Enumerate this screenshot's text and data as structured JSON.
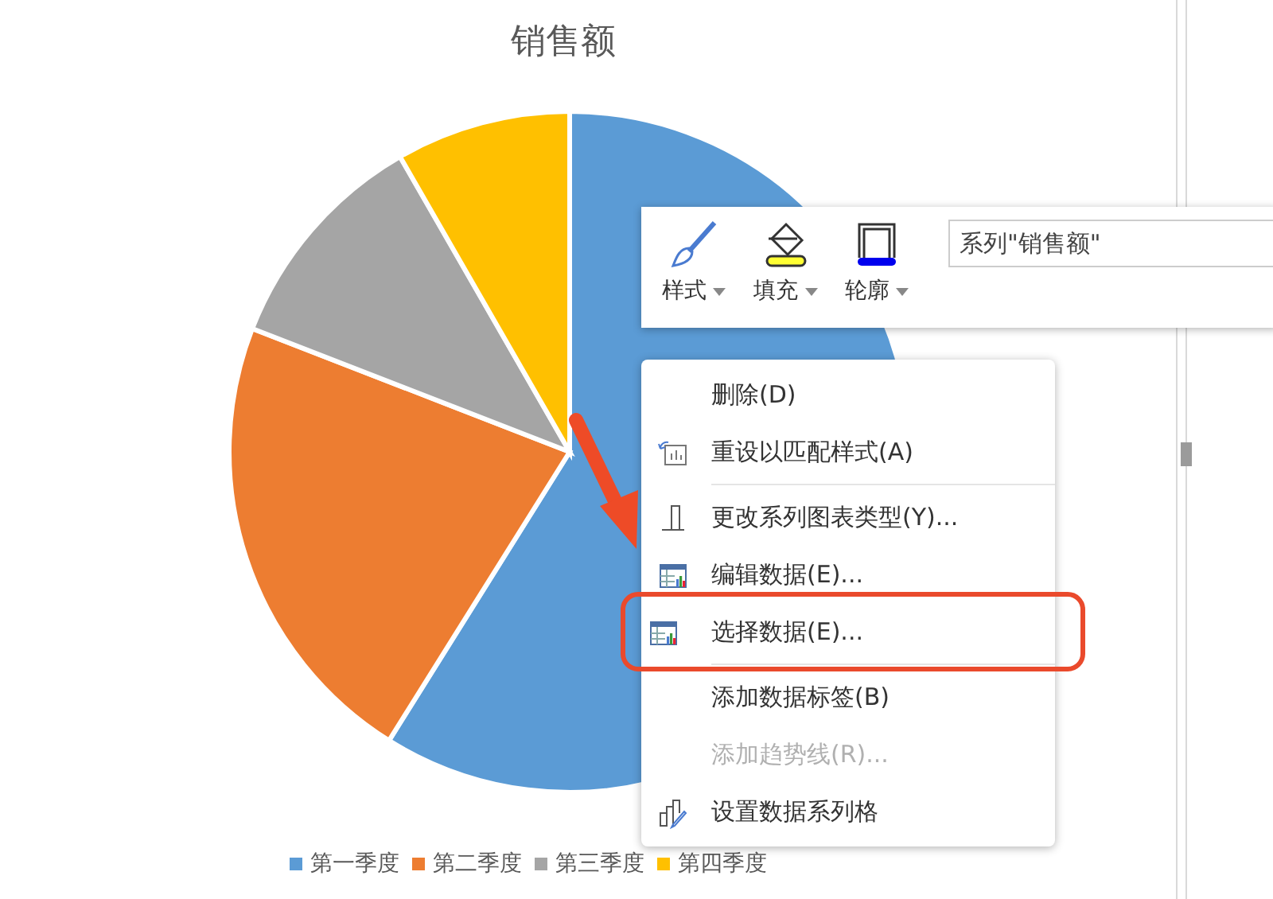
{
  "chart": {
    "title": "销售额",
    "legend": [
      {
        "label": "第一季度",
        "color": "#5b9bd5"
      },
      {
        "label": "第二季度",
        "color": "#ed7d31"
      },
      {
        "label": "第三季度",
        "color": "#a5a5a5"
      },
      {
        "label": "第四季度",
        "color": "#ffc000"
      }
    ]
  },
  "format_toolbar": {
    "buttons": [
      {
        "kind": "style",
        "label": "样式"
      },
      {
        "kind": "fill",
        "label": "填充"
      },
      {
        "kind": "outline",
        "label": "轮廓"
      }
    ],
    "series_field": {
      "value": "系列\"销售额\""
    }
  },
  "context_menu": {
    "items": [
      {
        "kind": "plain",
        "label": "删除(D)",
        "disabled": false,
        "highlighted": false
      },
      {
        "kind": "reset",
        "label": "重设以匹配样式(A)",
        "disabled": false,
        "highlighted": false
      },
      {
        "kind": "separator"
      },
      {
        "kind": "chart-type",
        "label": "更改系列图表类型(Y)...",
        "disabled": false,
        "highlighted": false
      },
      {
        "kind": "data",
        "label": "编辑数据(E)...",
        "disabled": false,
        "highlighted": false
      },
      {
        "kind": "data",
        "label": "选择数据(E)...",
        "disabled": false,
        "highlighted": true
      },
      {
        "kind": "separator"
      },
      {
        "kind": "plain",
        "label": "添加数据标签(B)",
        "disabled": false,
        "highlighted": false
      },
      {
        "kind": "plain",
        "label": "添加趋势线(R)...",
        "disabled": true,
        "highlighted": false
      },
      {
        "kind": "format",
        "label": "设置数据系列格",
        "disabled": false,
        "highlighted": false
      }
    ]
  }
}
